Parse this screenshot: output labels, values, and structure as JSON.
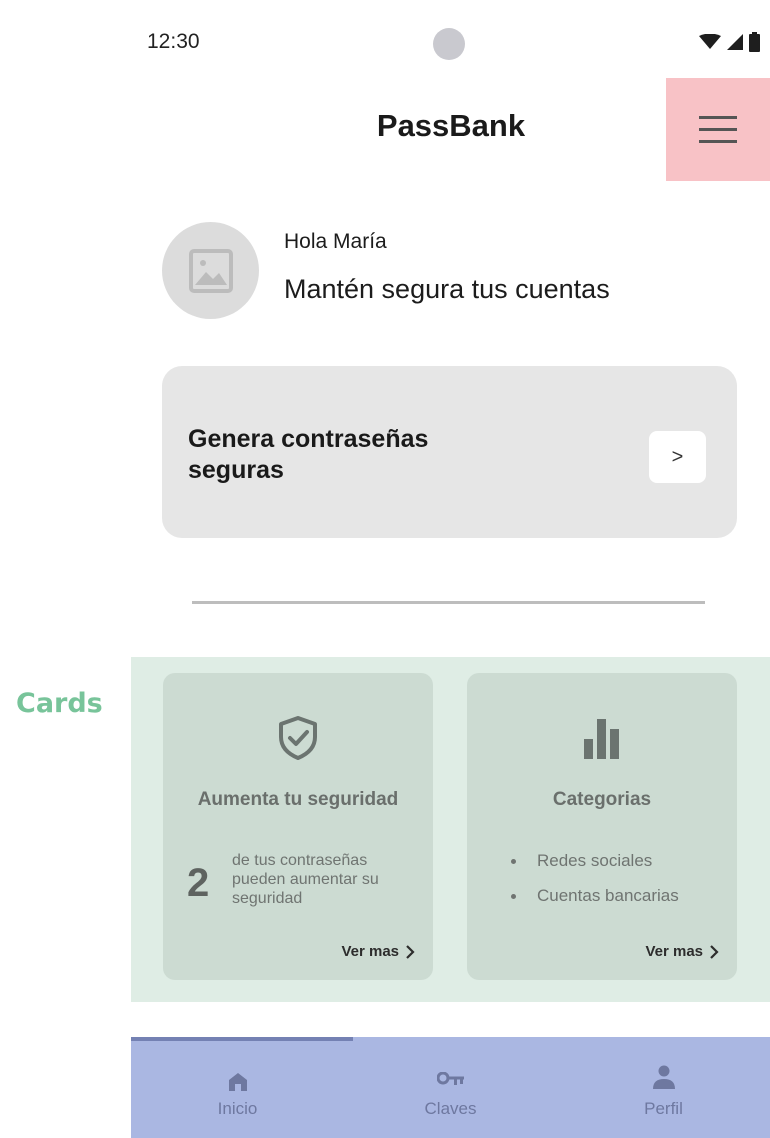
{
  "annotation": {
    "label": "Cards",
    "color": "#78c49a"
  },
  "status_bar": {
    "time": "12:30",
    "icons": [
      "wifi-icon",
      "signal-icon",
      "battery-icon"
    ]
  },
  "header": {
    "title": "PassBank",
    "menu_icon": "hamburger-menu-icon",
    "menu_highlight": "#f8c2c6"
  },
  "greeting": {
    "hello": "Hola María",
    "message": "Mantén segura tus cuentas",
    "avatar_icon": "image-placeholder-icon"
  },
  "generate_card": {
    "label": "Genera contraseñas seguras",
    "arrow": ">"
  },
  "cards": {
    "security": {
      "icon": "shield-check-icon",
      "title": "Aumenta tu seguridad",
      "count": "2",
      "count_text": "de tus contraseñas pueden aumentar su seguridad",
      "link": "Ver mas"
    },
    "categories": {
      "icon": "bar-chart-icon",
      "title": "Categorias",
      "items": [
        "Redes sociales",
        "Cuentas bancarias"
      ],
      "link": "Ver mas"
    }
  },
  "bottom_nav": {
    "items": [
      {
        "label": "Inicio",
        "icon": "home-icon"
      },
      {
        "label": "Claves",
        "icon": "key-icon"
      },
      {
        "label": "Perfil",
        "icon": "person-icon"
      }
    ],
    "active": "Inicio"
  },
  "colors": {
    "cards_region": "#dfede5",
    "card": "#ccdbd2",
    "nav": "#aab7e2"
  }
}
